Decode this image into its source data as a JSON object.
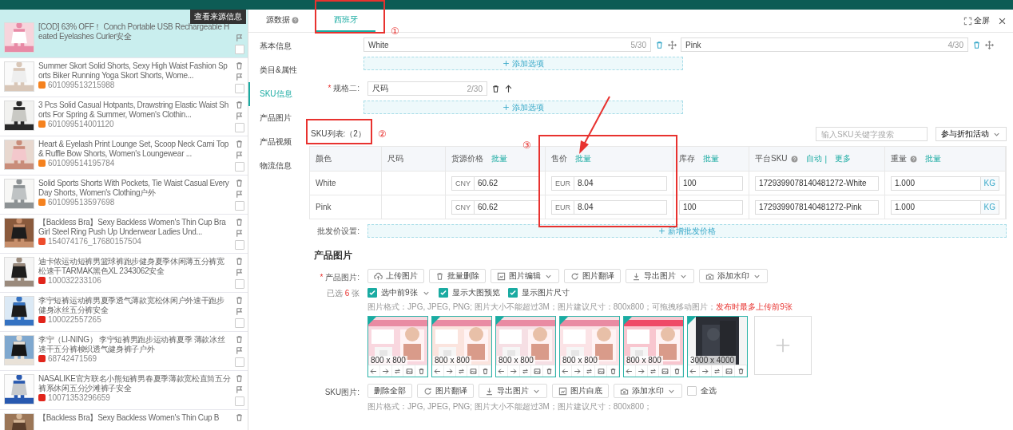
{
  "tooltip": "查看来源信息",
  "products": [
    {
      "title": "[COD] 63% OFF！ Conch Portable USB Rechargeable Heated Eyelashes Curler安全",
      "selected": true
    },
    {
      "title": "Summer Skort Solid Shorts, Sexy High Waist Fashion Sports Biker Running Yoga Skort Shorts, Wome...",
      "id": "601099513215988",
      "color": "#f5821f",
      "selected": false
    },
    {
      "title": "3 Pcs Solid Casual Hotpants, Drawstring Elastic Waist Shorts For Spring & Summer, Women's Clothin...",
      "id": "601099514001120",
      "color": "#f5821f",
      "selected": false
    },
    {
      "title": "Heart & Eyelash Print Lounge Set, Scoop Neck Cami Top & Ruffle Bow Shorts, Women's Loungewear ...",
      "id": "601099514195784",
      "color": "#f5821f",
      "selected": false
    },
    {
      "title": "Solid Sports Shorts With Pockets, Tie Waist Casual Every Day Shorts, Women's Clothing户外",
      "id": "601099513597698",
      "color": "#f5821f",
      "selected": false
    },
    {
      "title": "【Backless Bra】Sexy Backless Women's Thin Cup Bra Girl Steel Ring Push Up Underwear Ladies Und...",
      "id": "154074176_17680157504",
      "color": "#ee4d2d",
      "selected": false
    },
    {
      "title": "迪卡侬运动短裤男篮球裤跑步健身夏季休闲薄五分裤宽松速干TARMAK黑色XL 2343062安全",
      "id": "100032233106",
      "color": "#e1251b",
      "selected": false
    },
    {
      "title": "李宁短裤运动裤男夏季透气薄款宽松休闲户外速干跑步健身冰丝五分裤安全",
      "id": "100022557265",
      "color": "#e1251b",
      "selected": false
    },
    {
      "title": "李宁（LI-NING） 李宁短裤男跑步运动裤夏季 薄款冰丝速干五分裤梭织透气健身裤子户外",
      "id": "68742471569",
      "color": "#e1251b",
      "selected": false
    },
    {
      "title": "NASALIKE官方联名小熊短裤男春夏季薄款宽松直筒五分裤系休闲五分沙滩裤子安全",
      "id": "10071353296659",
      "color": "#e1251b",
      "selected": false
    },
    {
      "title": "【Backless Bra】Sexy Backless Women's Thin Cup B",
      "selected": false
    }
  ],
  "tabs": [
    {
      "label": "源数据",
      "help": true,
      "selected": false
    },
    {
      "label": "西班牙",
      "help": false,
      "selected": true
    }
  ],
  "fullscreen": "全屏",
  "nav": [
    {
      "label": "基本信息",
      "selected": false
    },
    {
      "label": "类目&属性",
      "selected": false
    },
    {
      "label": "SKU信息",
      "selected": true
    },
    {
      "label": "产品图片",
      "selected": false
    },
    {
      "label": "产品视频",
      "selected": false
    },
    {
      "label": "物流信息",
      "selected": false
    }
  ],
  "spec1": {
    "options": [
      {
        "value": "White",
        "count": "5/30"
      },
      {
        "value": "Pink",
        "count": "4/30"
      }
    ],
    "add": "添加选项"
  },
  "spec2": {
    "label": "规格二:",
    "required_mark": "*",
    "value": "尺码",
    "count": "2/30",
    "add": "添加选项"
  },
  "sku": {
    "title": "SKU列表:（2）",
    "search_placeholder": "输入SKU关键字搜索",
    "discount": "参与折扣活动",
    "columns": [
      {
        "label": "颜色"
      },
      {
        "label": "尺码"
      },
      {
        "label": "货源价格",
        "actions": [
          "批量"
        ]
      },
      {
        "label": "售价",
        "actions": [
          "批量"
        ]
      },
      {
        "label": "库存",
        "actions": [
          "批量"
        ]
      },
      {
        "label": "平台SKU",
        "help": true,
        "actions": [
          "自动",
          "更多"
        ],
        "separator": "|"
      },
      {
        "label": "重量",
        "help": true,
        "actions": [
          "批量"
        ]
      }
    ],
    "rows": [
      {
        "spec_value": "White",
        "cost_currency": "CNY",
        "cost": "60.62",
        "price_currency": "EUR",
        "price": "8.04",
        "stock": "100",
        "platform_sku": "1729399078140481272-White",
        "weight": "1.000",
        "weight_unit": "KG"
      },
      {
        "spec_value": "Pink",
        "cost_currency": "CNY",
        "cost": "60.62",
        "price_currency": "EUR",
        "price": "8.04",
        "stock": "100",
        "platform_sku": "1729399078140481272-Pink",
        "weight": "1.000",
        "weight_unit": "KG"
      }
    ]
  },
  "wholesale": {
    "label": "批发价设置:",
    "add": "新增批发价格"
  },
  "images": {
    "heading": "产品图片",
    "label": "产品图片:",
    "required_mark": "*",
    "selected_before": "已选",
    "selected_count": "6",
    "selected_after": "张",
    "toolbar": [
      {
        "label": "上传图片",
        "kind": "upload",
        "dropdown": false
      },
      {
        "label": "批量删除",
        "kind": "trash",
        "dropdown": false
      },
      {
        "label": "图片编辑",
        "kind": "edit",
        "dropdown": true
      },
      {
        "label": "图片翻译",
        "kind": "refresh",
        "dropdown": false
      },
      {
        "label": "导出图片",
        "kind": "download",
        "dropdown": true
      },
      {
        "label": "添加水印",
        "kind": "watermark",
        "dropdown": true
      }
    ],
    "options": [
      {
        "label": "选中前9张",
        "checked": true,
        "dropdown": true
      },
      {
        "label": "显示大图预览",
        "checked": true,
        "dropdown": false
      },
      {
        "label": "显示图片尺寸",
        "checked": true,
        "dropdown": false
      }
    ],
    "hint": "图片格式：JPG, JPEG, PNG; 图片大小不能超过3M；图片建议尺寸：800x800；可拖拽移动图片；",
    "warning": "发布时最多上传前9张",
    "tiles": [
      {
        "size": "800 x 800"
      },
      {
        "size": "800 x 800"
      },
      {
        "size": "800 x 800"
      },
      {
        "size": "800 x 800"
      },
      {
        "size": "800 x 800"
      },
      {
        "size": "3000 x 4000"
      }
    ]
  },
  "sku_images": {
    "label": "SKU图片:",
    "toolbar": [
      {
        "label": "删除全部",
        "dropdown": false
      },
      {
        "label": "图片翻译",
        "kind": "refresh",
        "dropdown": false
      },
      {
        "label": "导出图片",
        "kind": "download",
        "dropdown": true
      },
      {
        "label": "图片白底",
        "kind": "edit",
        "dropdown": false
      },
      {
        "label": "添加水印",
        "kind": "watermark",
        "dropdown": true
      }
    ],
    "select_all": {
      "label": "全选",
      "checked": false
    },
    "hint": "图片格式：JPG, JPEG, PNG; 图片大小不能超过3M；图片建议尺寸：800x800；"
  },
  "annotations": [
    {
      "mark": "①"
    },
    {
      "mark": "②"
    },
    {
      "mark": "③"
    }
  ]
}
